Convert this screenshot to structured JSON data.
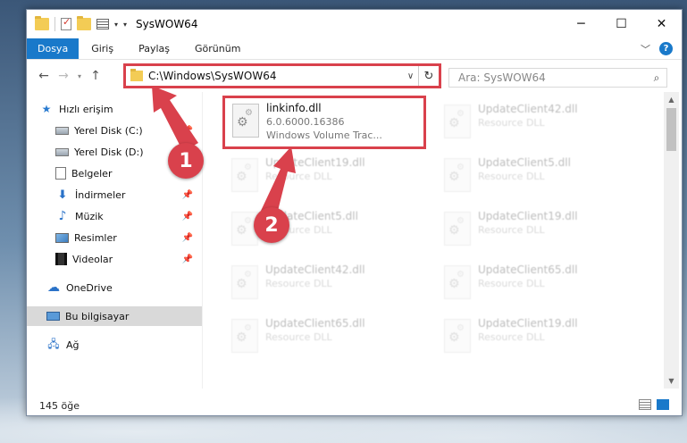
{
  "window": {
    "title": "SysWOW64"
  },
  "ribbon": {
    "tabs": [
      {
        "label": "Dosya"
      },
      {
        "label": "Giriş"
      },
      {
        "label": "Paylaş"
      },
      {
        "label": "Görünüm"
      }
    ],
    "help": "?"
  },
  "nav": {
    "address": "C:\\Windows\\SysWOW64",
    "search_placeholder": "Ara: SysWOW64"
  },
  "sidebar": {
    "items": [
      {
        "label": "Hızlı erişim",
        "icon": "star-icon"
      },
      {
        "label": "Yerel Disk (C:)",
        "icon": "drive-icon",
        "pinned": true
      },
      {
        "label": "Yerel Disk (D:)",
        "icon": "drive-icon"
      },
      {
        "label": "Belgeler",
        "icon": "documents-icon"
      },
      {
        "label": "İndirmeler",
        "icon": "download-icon",
        "pinned": true
      },
      {
        "label": "Müzik",
        "icon": "music-icon",
        "pinned": true
      },
      {
        "label": "Resimler",
        "icon": "pictures-icon",
        "pinned": true
      },
      {
        "label": "Videolar",
        "icon": "video-icon",
        "pinned": true
      },
      {
        "label": "OneDrive",
        "icon": "cloud-icon"
      },
      {
        "label": "Bu bilgisayar",
        "icon": "computer-icon",
        "selected": true
      },
      {
        "label": "Ağ",
        "icon": "network-icon"
      }
    ]
  },
  "files": [
    {
      "name": "linkinfo.dll",
      "line2": "6.0.6000.16386",
      "line3": "Windows Volume Trac...",
      "highlighted": true
    },
    {
      "name": "UpdateClient42.dll",
      "line2": "Resource DLL"
    },
    {
      "name": "UpdateClient19.dll",
      "line2": "Resource DLL"
    },
    {
      "name": "UpdateClient5.dll",
      "line2": "Resource DLL"
    },
    {
      "name": "UpdateClient5.dll",
      "line2": "Resource DLL"
    },
    {
      "name": "UpdateClient19.dll",
      "line2": "Resource DLL"
    },
    {
      "name": "UpdateClient42.dll",
      "line2": "Resource DLL"
    },
    {
      "name": "UpdateClient65.dll",
      "line2": "Resource DLL"
    },
    {
      "name": "UpdateClient65.dll",
      "line2": "Resource DLL"
    },
    {
      "name": "UpdateClient19.dll",
      "line2": "Resource DLL"
    }
  ],
  "status": {
    "count": "145 öğe"
  },
  "annotations": {
    "step1": "1",
    "step2": "2",
    "color": "#d9414c"
  }
}
